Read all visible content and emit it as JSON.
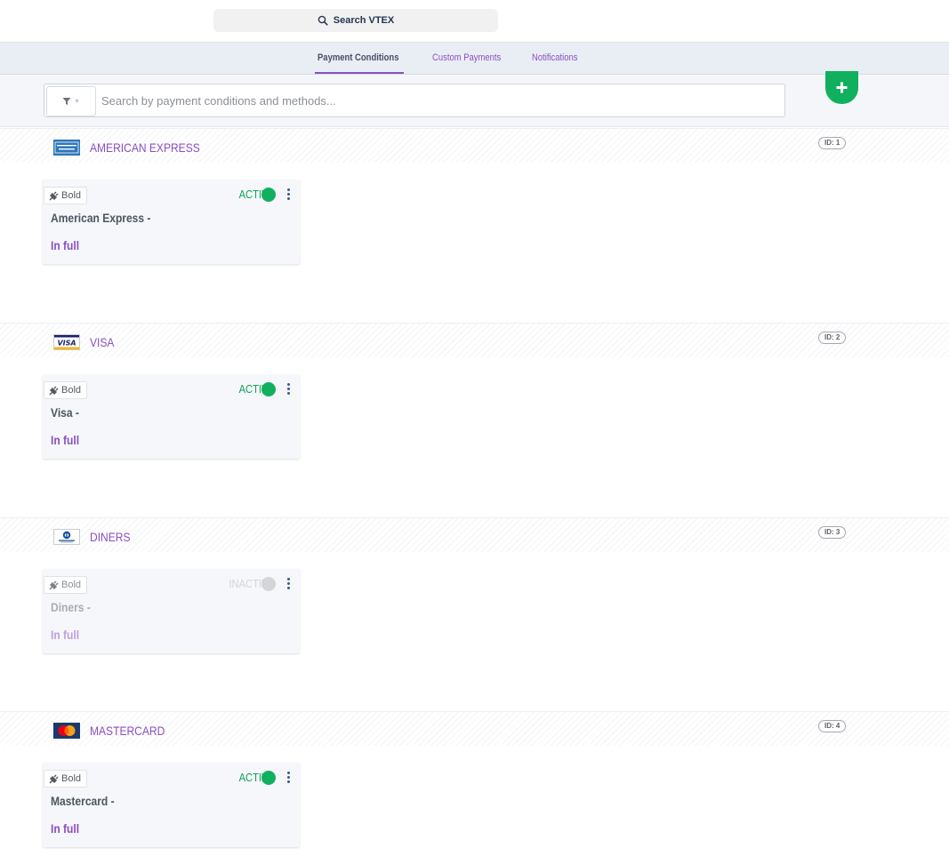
{
  "header": {
    "global_search_label": "Search VTEX",
    "search_icon": "search-icon"
  },
  "tabs": [
    {
      "label": "Payment Conditions",
      "active": true
    },
    {
      "label": "Custom Payments",
      "active": false
    },
    {
      "label": "Notifications",
      "active": false
    }
  ],
  "filter": {
    "filter_icon": "funnel-icon",
    "placeholder": "Search by payment conditions and methods..."
  },
  "add_button": {
    "icon": "plus-icon",
    "color": "#11b05e"
  },
  "colors": {
    "accent": "#8b4fbf",
    "active": "#11b05e",
    "inactive": "#d3d5d9"
  },
  "sections": [
    {
      "brand": "AMERICAN EXPRESS",
      "id_label": "ID: 1",
      "logo_icon": "amex-logo-icon",
      "card": {
        "connector": "Bold",
        "status": "ACTIVE",
        "active": true,
        "name": "American Express -",
        "installments": "In full"
      }
    },
    {
      "brand": "VISA",
      "id_label": "ID: 2",
      "logo_icon": "visa-logo-icon",
      "card": {
        "connector": "Bold",
        "status": "ACTIVE",
        "active": true,
        "name": "Visa -",
        "installments": "In full"
      }
    },
    {
      "brand": "DINERS",
      "id_label": "ID: 3",
      "logo_icon": "diners-logo-icon",
      "card": {
        "connector": "Bold",
        "status": "INACTIVE",
        "active": false,
        "name": "Diners -",
        "installments": "In full"
      }
    },
    {
      "brand": "MASTERCARD",
      "id_label": "ID: 4",
      "logo_icon": "mastercard-logo-icon",
      "card": {
        "connector": "Bold",
        "status": "ACTIVE",
        "active": true,
        "name": "Mastercard -",
        "installments": "In full"
      }
    }
  ]
}
